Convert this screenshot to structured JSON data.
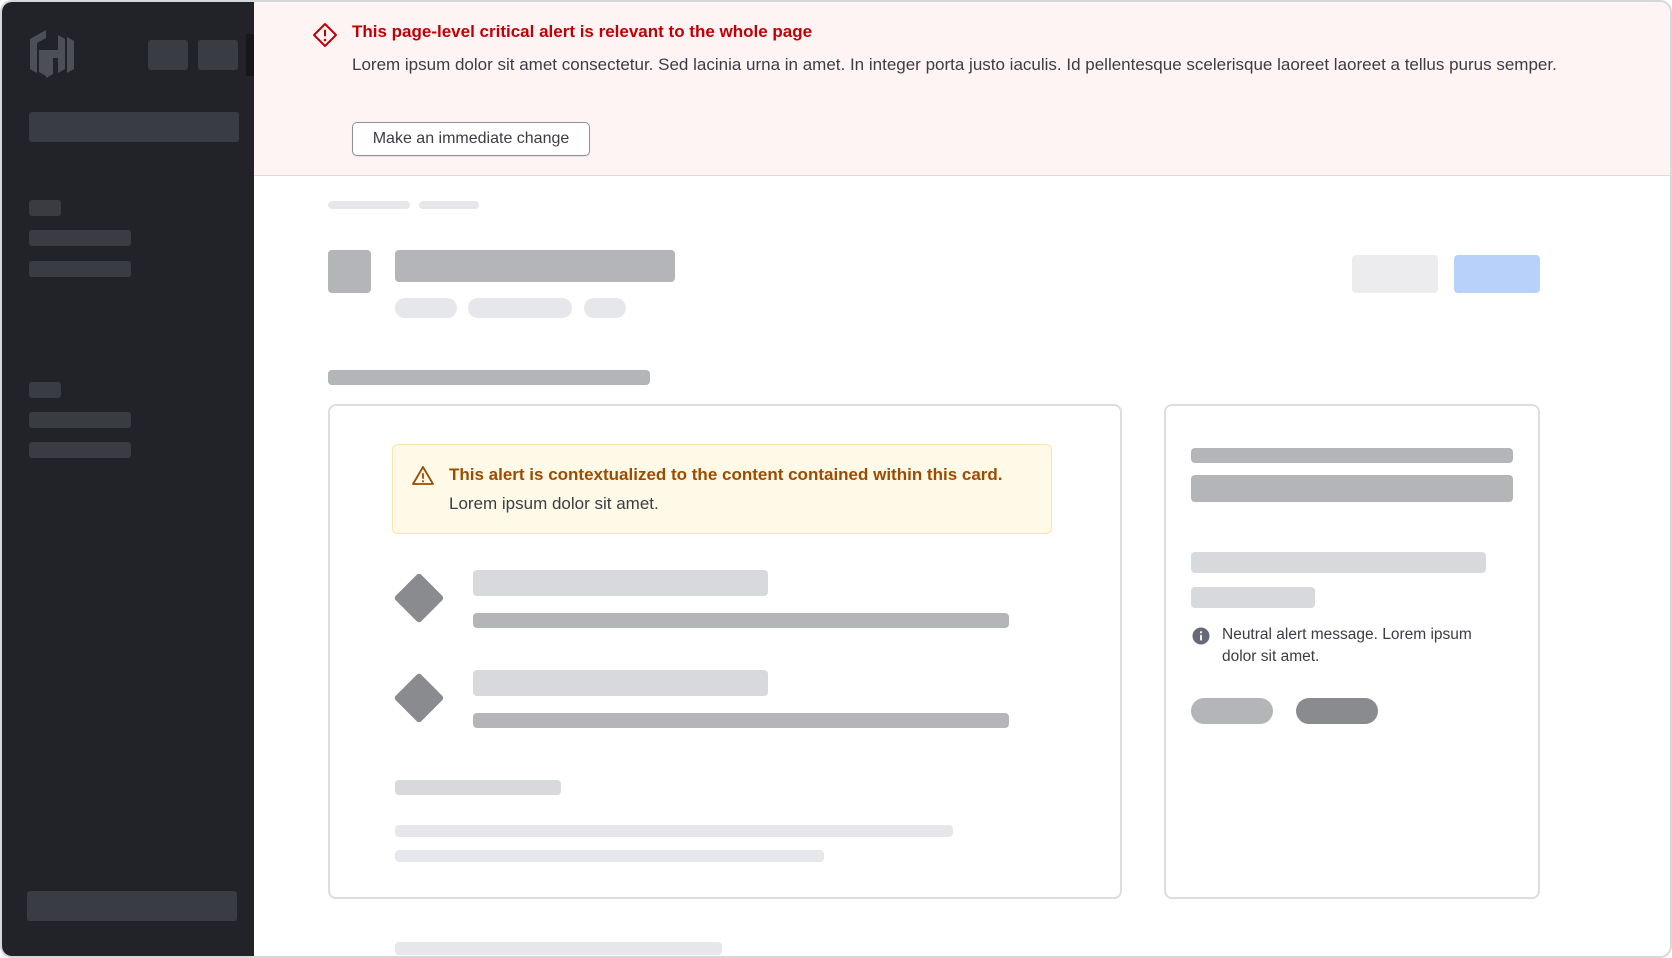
{
  "page_alert": {
    "type": "critical",
    "title": "This page-level critical alert is relevant to the whole page",
    "description": "Lorem ipsum dolor sit amet consectetur. Sed lacinia urna in amet. In integer porta justo iaculis. Id pellentesque scelerisque laoreet laoreet a tellus purus semper.",
    "action_label": "Make an immediate change",
    "icon": "alert-diamond-icon",
    "color": "#c00005",
    "background": "#fff4f4"
  },
  "card_alert": {
    "type": "warning",
    "title": "This alert is contextualized to the content contained within this card.",
    "description": "Lorem ipsum dolor sit amet.",
    "icon": "alert-triangle-icon",
    "color": "#9e4b00",
    "background": "#fff9e8"
  },
  "neutral_alert": {
    "type": "neutral",
    "description": "Neutral alert message. Lorem ipsum dolor sit amet.",
    "icon": "info-icon"
  },
  "sidebar": {
    "logo": "hashicorp-logo",
    "background": "#222328"
  },
  "colors": {
    "primary_button_placeholder": "#b7d1fb",
    "secondary_button_placeholder": "#ececee"
  }
}
